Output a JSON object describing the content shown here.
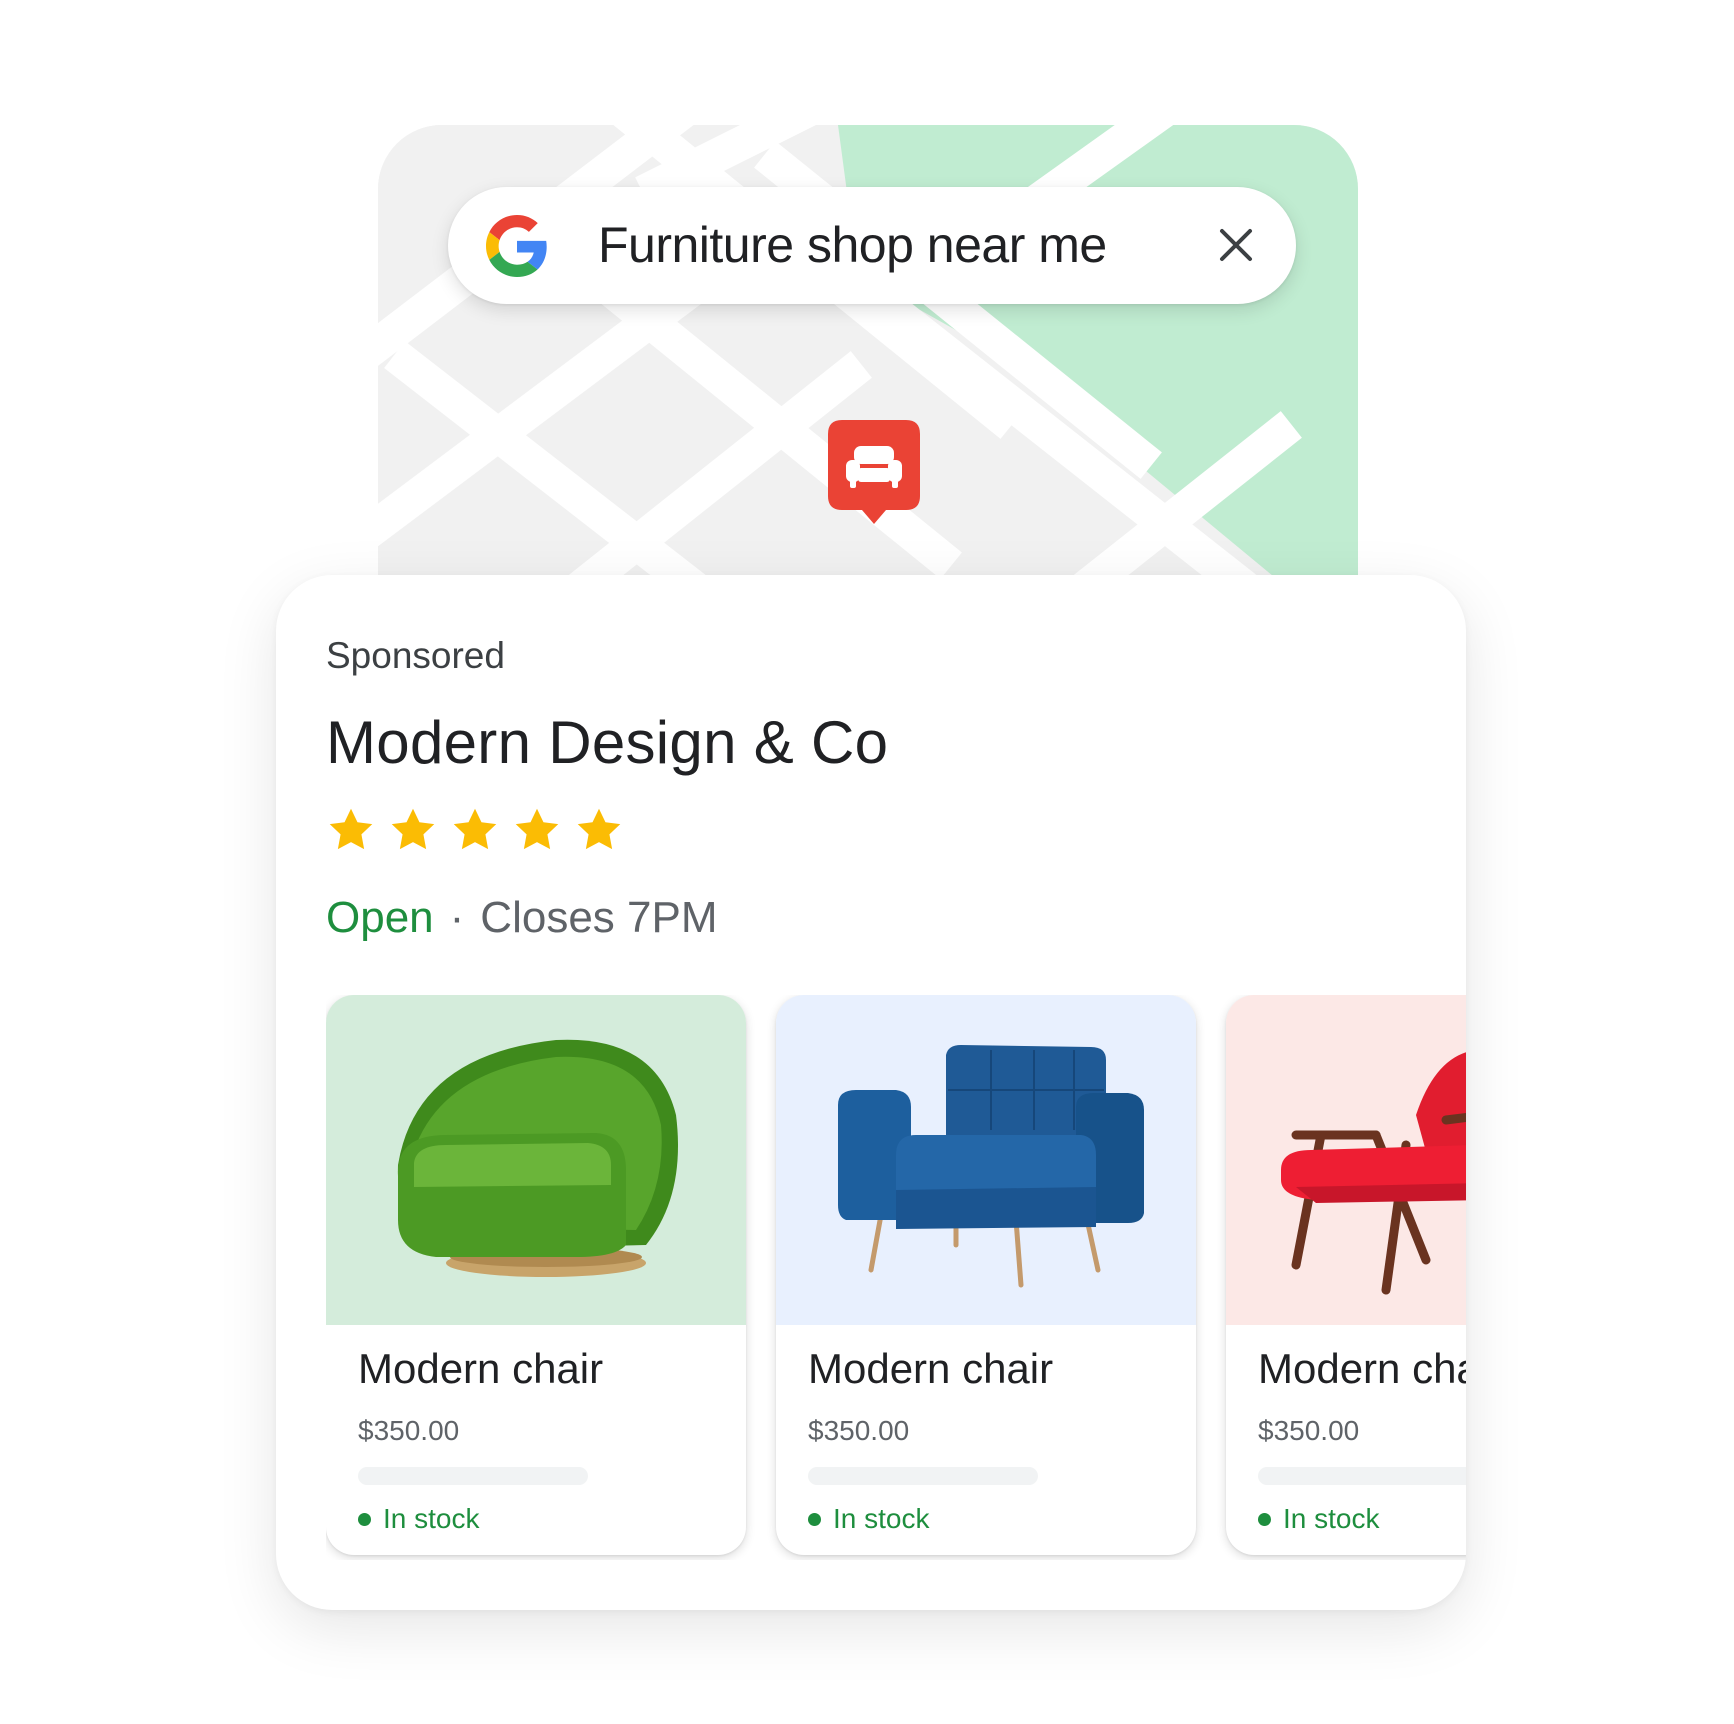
{
  "search": {
    "query": "Furniture shop near me",
    "logo_icon": "google-g-icon",
    "clear_icon": "close-icon"
  },
  "map": {
    "pin_icon": "armchair-store-pin-icon",
    "colors": {
      "land": "#f1f1f1",
      "road": "#ffffff",
      "park": "#c0ecd1",
      "pin": "#ea4335"
    }
  },
  "business": {
    "sponsored_label": "Sponsored",
    "name": "Modern Design & Co",
    "rating_stars": 5,
    "status": "Open",
    "separator": "·",
    "closing": "Closes 7PM",
    "colors": {
      "open": "#1e8e3e",
      "star": "#fbbc04"
    }
  },
  "products": [
    {
      "name": "Modern chair",
      "price": "$350.00",
      "stock": "In stock",
      "image": "green-armchair",
      "bg": "#d4ecdb"
    },
    {
      "name": "Modern chair",
      "price": "$350.00",
      "stock": "In stock",
      "image": "blue-armchair",
      "bg": "#e8f0fe"
    },
    {
      "name": "Modern chair",
      "price": "$350.00",
      "stock": "In stock",
      "image": "red-lounge-chair",
      "bg": "#fce8e6"
    }
  ]
}
